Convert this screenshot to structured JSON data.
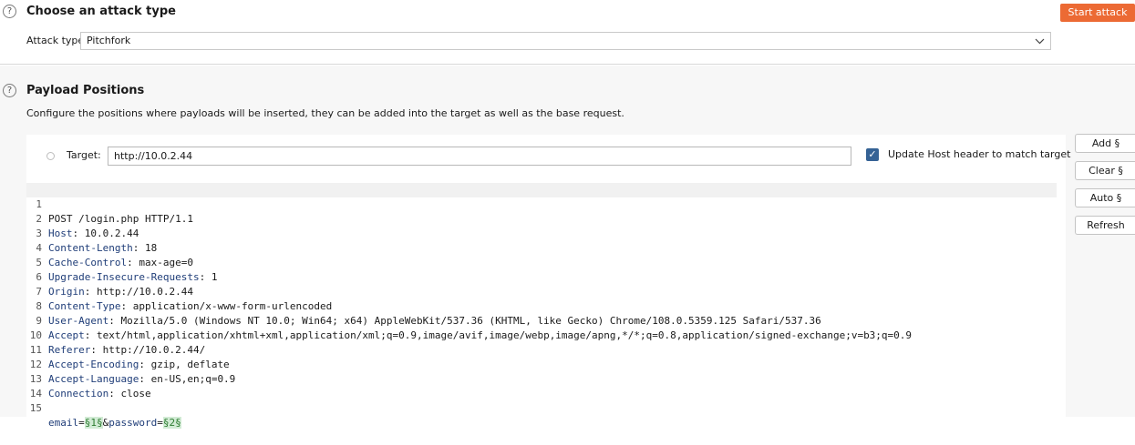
{
  "attack_type_section": {
    "title": "Choose an attack type",
    "attack_type_label": "Attack type:",
    "attack_type_value": "Pitchfork",
    "start_attack_label": "Start attack"
  },
  "payload_positions": {
    "title": "Payload Positions",
    "description": "Configure the positions where payloads will be inserted, they can be added into the target as well as the base request.",
    "target_label": "Target:",
    "target_value": "http://10.0.2.44",
    "update_host_label": "Update Host header to match target",
    "update_host_checked": true,
    "buttons": {
      "add": "Add §",
      "clear": "Clear §",
      "auto": "Auto §",
      "refresh": "Refresh"
    }
  },
  "request": {
    "request_line": "POST /login.php HTTP/1.1",
    "headers": [
      {
        "name": "Host",
        "value": " 10.0.2.44"
      },
      {
        "name": "Content-Length",
        "value": " 18"
      },
      {
        "name": "Cache-Control",
        "value": " max-age=0"
      },
      {
        "name": "Upgrade-Insecure-Requests",
        "value": " 1"
      },
      {
        "name": "Origin",
        "value": " http://10.0.2.44"
      },
      {
        "name": "Content-Type",
        "value": " application/x-www-form-urlencoded"
      },
      {
        "name": "User-Agent",
        "value": " Mozilla/5.0 (Windows NT 10.0; Win64; x64) AppleWebKit/537.36 (KHTML, like Gecko) Chrome/108.0.5359.125 Safari/537.36"
      },
      {
        "name": "Accept",
        "value": " text/html,application/xhtml+xml,application/xml;q=0.9,image/avif,image/webp,image/apng,*/*;q=0.8,application/signed-exchange;v=b3;q=0.9"
      },
      {
        "name": "Referer",
        "value": " http://10.0.2.44/"
      },
      {
        "name": "Accept-Encoding",
        "value": " gzip, deflate"
      },
      {
        "name": "Accept-Language",
        "value": " en-US,en;q=0.9"
      },
      {
        "name": "Connection",
        "value": " close"
      }
    ],
    "body": {
      "param1_name": "email",
      "eq": "=",
      "marker1": "§1§",
      "amp": "&",
      "param2_name": "password",
      "marker2": "§2§"
    },
    "line_numbers": [
      "1",
      "2",
      "3",
      "4",
      "5",
      "6",
      "7",
      "8",
      "9",
      "10",
      "11",
      "12",
      "13",
      "14",
      "15"
    ],
    "colon": ":"
  },
  "icons": {
    "help": "help-circle-icon",
    "chevron": "chevron-down-icon",
    "radio": "radio-icon",
    "check": "checkbox-checked-icon"
  },
  "colors": {
    "accent": "#ec6a34",
    "checkbox": "#356295",
    "header_name": "#1f3d78",
    "marker_bg": "#d2ebd5"
  }
}
